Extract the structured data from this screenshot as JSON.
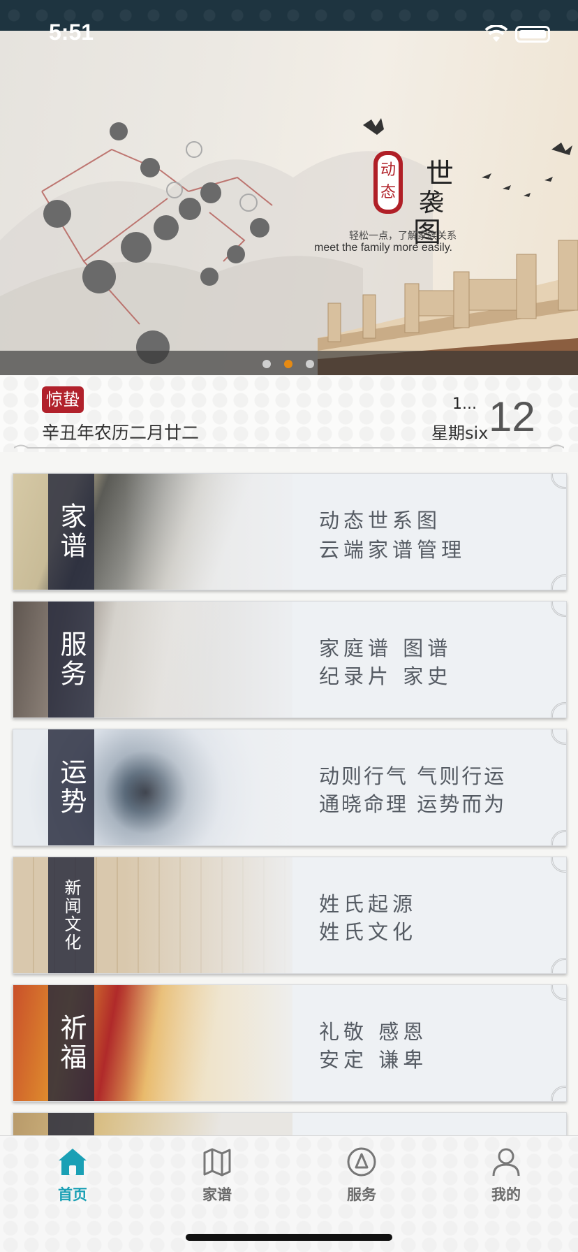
{
  "status_bar": {
    "time": "5:51"
  },
  "banner": {
    "badge_text": "动态",
    "title_text": "世袭图",
    "slogan": "轻松一点，了解家族关系",
    "slogan_en": "meet the family more easily.",
    "slide_index": 2,
    "slide_count": 3
  },
  "calendar": {
    "solar_term": "惊蛰",
    "lunar_date": "辛丑年农历二月廿二",
    "month": "1...",
    "weekday": "星期six",
    "day": "12"
  },
  "cards": [
    {
      "title": "家谱",
      "line1": "动态世系图",
      "line2": "云端家谱管理"
    },
    {
      "title": "服务",
      "line1": "家庭谱 图谱",
      "line2": "纪录片 家史"
    },
    {
      "title": "运势",
      "line1": "动则行气 气则行运",
      "line2": "通晓命理 运势而为"
    },
    {
      "title": "新闻文化",
      "line1": "姓氏起源",
      "line2": "姓氏文化"
    },
    {
      "title": "祈福",
      "line1": "礼敬 感恩",
      "line2": "安定 谦卑"
    }
  ],
  "tab_bar": {
    "active_color": "#1aa0b5",
    "items": [
      {
        "label": "首页",
        "icon": "home-icon"
      },
      {
        "label": "家谱",
        "icon": "map-icon"
      },
      {
        "label": "服务",
        "icon": "compass-icon"
      },
      {
        "label": "我的",
        "icon": "user-icon"
      }
    ]
  }
}
